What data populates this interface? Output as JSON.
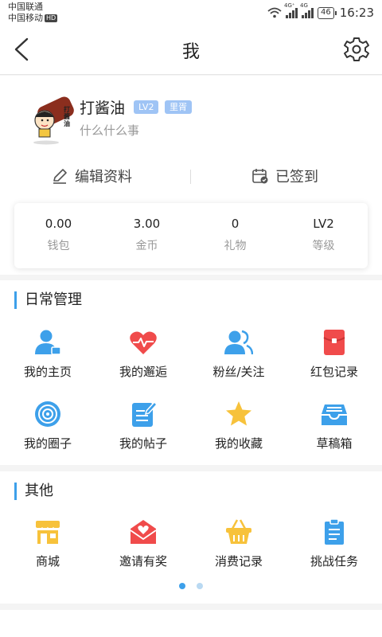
{
  "status_bar": {
    "carrier1": "中国联通",
    "carrier2": "中国移动",
    "hd": "HD",
    "net1": "4G⁺",
    "net2": "4G",
    "battery": "46",
    "time": "16:23"
  },
  "nav": {
    "title": "我",
    "back_icon": "chevron-left-icon",
    "settings_icon": "gear-icon"
  },
  "profile": {
    "avatar_text": "打酱油",
    "name": "打酱油",
    "level_badge": "LV2",
    "tag_badge": "里胥",
    "signature": "什么什么事"
  },
  "actions": {
    "edit": "编辑资料",
    "sign": "已签到"
  },
  "stats": [
    {
      "value": "0.00",
      "label": "钱包"
    },
    {
      "value": "3.00",
      "label": "金币"
    },
    {
      "value": "0",
      "label": "礼物"
    },
    {
      "value": "LV2",
      "label": "等级"
    }
  ],
  "daily": {
    "title": "日常管理",
    "items": [
      {
        "label": "我的主页",
        "icon": "user-home-icon"
      },
      {
        "label": "我的邂逅",
        "icon": "heart-pulse-icon"
      },
      {
        "label": "粉丝/关注",
        "icon": "followers-icon"
      },
      {
        "label": "红包记录",
        "icon": "red-packet-icon"
      },
      {
        "label": "我的圈子",
        "icon": "circle-target-icon"
      },
      {
        "label": "我的帖子",
        "icon": "post-edit-icon"
      },
      {
        "label": "我的收藏",
        "icon": "star-icon"
      },
      {
        "label": "草稿箱",
        "icon": "drafts-tray-icon"
      }
    ]
  },
  "other": {
    "title": "其他",
    "items": [
      {
        "label": "商城",
        "icon": "shop-icon"
      },
      {
        "label": "邀请有奖",
        "icon": "invite-envelope-icon"
      },
      {
        "label": "消费记录",
        "icon": "basket-icon"
      },
      {
        "label": "挑战任务",
        "icon": "task-clipboard-icon"
      }
    ],
    "page_count": 2,
    "active_page": 1
  },
  "colors": {
    "accent": "#3da0ea",
    "red": "#f04b4b",
    "yellow": "#f7c23b",
    "blue": "#3da0ea"
  }
}
